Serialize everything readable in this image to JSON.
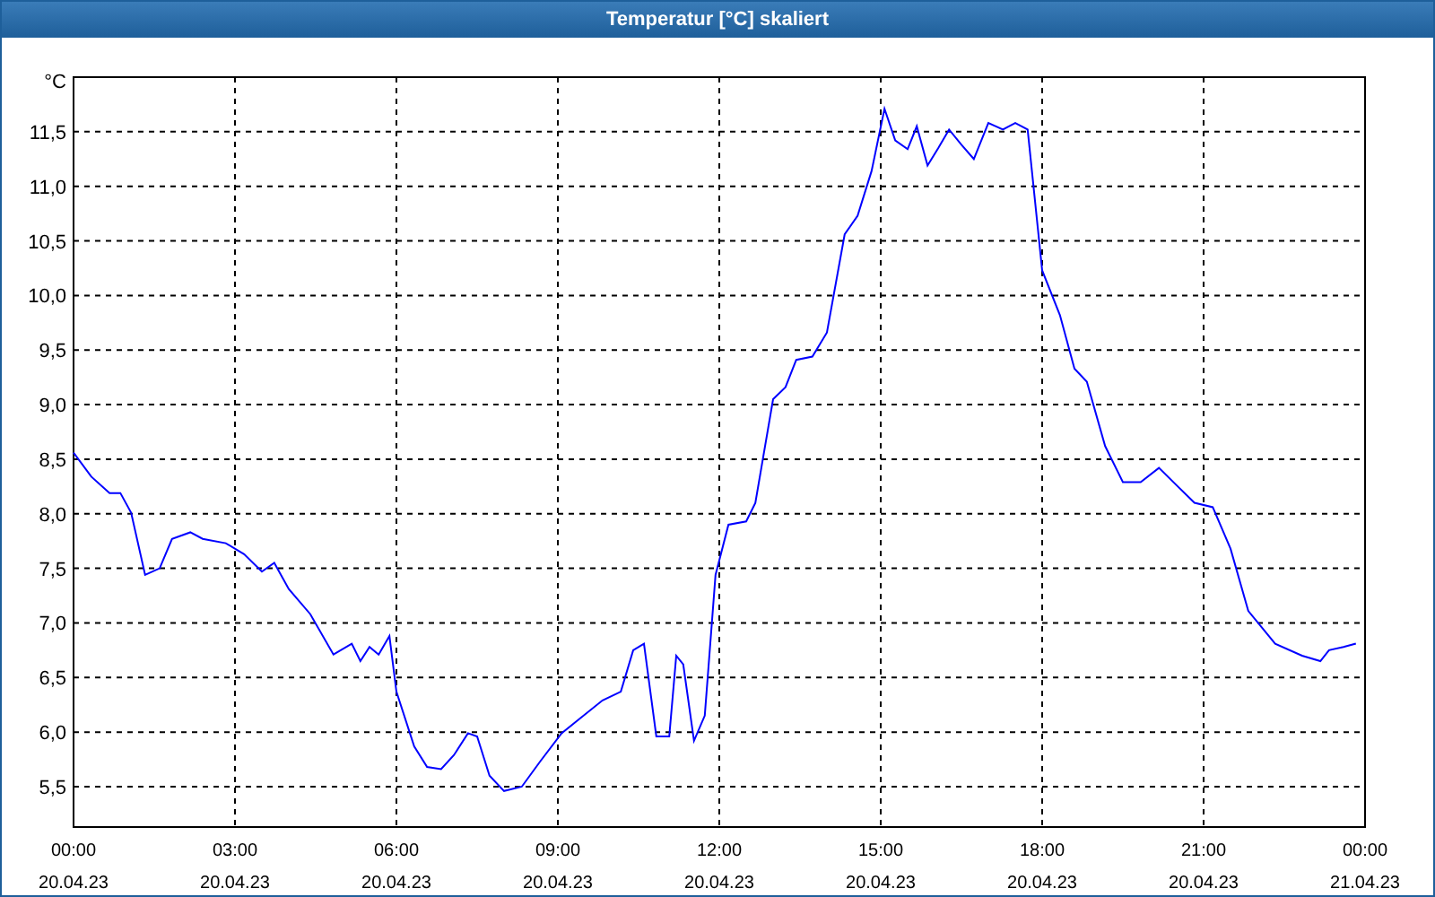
{
  "window": {
    "title": "Temperatur [°C] skaliert"
  },
  "chart": {
    "chart_data": {
      "type": "line",
      "grid": true,
      "ylabel": "°C",
      "xlim": [
        0,
        24
      ],
      "ylim": [
        5.13,
        12.0
      ],
      "xticks": [
        {
          "value": 0,
          "label": "00:00"
        },
        {
          "value": 3,
          "label": "03:00"
        },
        {
          "value": 6,
          "label": "06:00"
        },
        {
          "value": 9,
          "label": "09:00"
        },
        {
          "value": 12,
          "label": "12:00"
        },
        {
          "value": 15,
          "label": "15:00"
        },
        {
          "value": 18,
          "label": "18:00"
        },
        {
          "value": 21,
          "label": "21:00"
        },
        {
          "value": 24,
          "label": "00:00"
        }
      ],
      "yticks": [
        {
          "value": 5.5,
          "label": "5,5"
        },
        {
          "value": 6,
          "label": "6,0"
        },
        {
          "value": 6.5,
          "label": "6,5"
        },
        {
          "value": 7,
          "label": "7,0"
        },
        {
          "value": 7.5,
          "label": "7,5"
        },
        {
          "value": 8,
          "label": "8,0"
        },
        {
          "value": 8.5,
          "label": "8,5"
        },
        {
          "value": 9,
          "label": "9,0"
        },
        {
          "value": 9.5,
          "label": "9,5"
        },
        {
          "value": 10,
          "label": "10,0"
        },
        {
          "value": 10.5,
          "label": "10,5"
        },
        {
          "value": 11,
          "label": "11,0"
        },
        {
          "value": 11.5,
          "label": "11,5"
        }
      ],
      "x": [
        0,
        0.33,
        0.67,
        0.87,
        1.07,
        1.33,
        1.6,
        1.83,
        2.17,
        2.4,
        2.83,
        3.17,
        3.5,
        3.73,
        4.0,
        4.4,
        4.83,
        5.17,
        5.33,
        5.5,
        5.67,
        5.87,
        6.0,
        6.33,
        6.57,
        6.83,
        7.07,
        7.33,
        7.5,
        7.73,
        8.0,
        8.33,
        8.67,
        9.07,
        9.4,
        9.83,
        10.17,
        10.4,
        10.6,
        10.83,
        11.07,
        11.2,
        11.33,
        11.53,
        11.73,
        11.93,
        12.17,
        12.5,
        12.67,
        13.0,
        13.23,
        13.43,
        13.73,
        14.0,
        14.33,
        14.57,
        14.83,
        15.07,
        15.27,
        15.5,
        15.67,
        15.87,
        16.07,
        16.27,
        16.5,
        16.73,
        17.0,
        17.27,
        17.5,
        17.73,
        18.0,
        18.33,
        18.6,
        18.83,
        19.17,
        19.5,
        19.83,
        20.17,
        20.5,
        20.83,
        21.17,
        21.5,
        21.83,
        22.33,
        22.83,
        23.17,
        23.33,
        23.6,
        23.83
      ],
      "series": [
        {
          "color": "#0000ff",
          "values": [
            8.56,
            8.34,
            8.19,
            8.19,
            8.01,
            7.44,
            7.5,
            7.77,
            7.83,
            7.77,
            7.73,
            7.63,
            7.47,
            7.55,
            7.31,
            7.08,
            6.71,
            6.81,
            6.65,
            6.78,
            6.71,
            6.88,
            6.37,
            5.87,
            5.68,
            5.66,
            5.79,
            5.99,
            5.96,
            5.6,
            5.46,
            5.5,
            5.73,
            5.99,
            6.12,
            6.29,
            6.37,
            6.75,
            6.81,
            5.96,
            5.96,
            6.7,
            6.62,
            5.92,
            6.15,
            7.44,
            7.9,
            7.93,
            8.1,
            9.05,
            9.16,
            9.41,
            9.44,
            9.66,
            10.56,
            10.73,
            11.14,
            11.71,
            11.42,
            11.34,
            11.55,
            11.19,
            11.35,
            11.52,
            11.38,
            11.25,
            11.58,
            11.52,
            11.58,
            11.52,
            10.23,
            9.82,
            9.33,
            9.21,
            8.62,
            8.29,
            8.29,
            8.42,
            8.26,
            8.1,
            8.06,
            7.68,
            7.11,
            6.81,
            6.7,
            6.65,
            6.75,
            6.78,
            6.81
          ]
        }
      ]
    },
    "date_labels": [
      "20.04.23",
      "20.04.23",
      "20.04.23",
      "20.04.23",
      "20.04.23",
      "20.04.23",
      "20.04.23",
      "20.04.23",
      "21.04.23"
    ]
  }
}
